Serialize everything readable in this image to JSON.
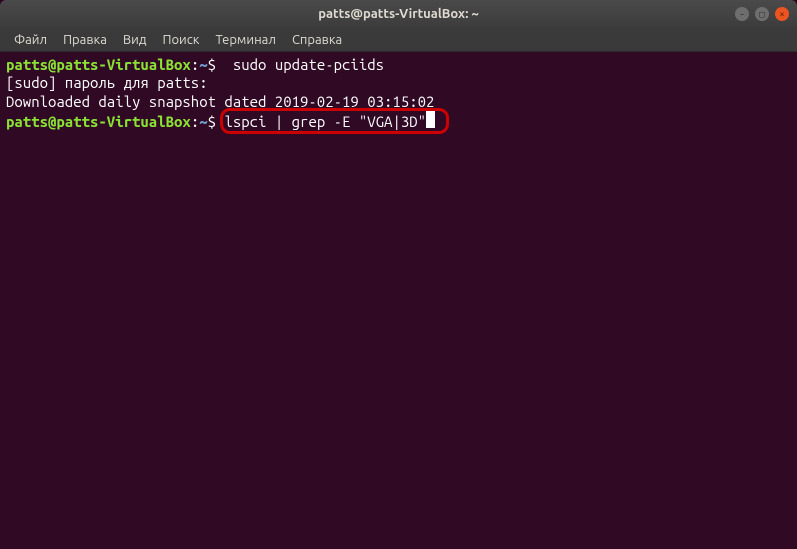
{
  "window": {
    "title": "patts@patts-VirtualBox: ~"
  },
  "menu": {
    "file": "Файл",
    "edit": "Правка",
    "view": "Вид",
    "search": "Поиск",
    "terminal": "Терминал",
    "help": "Справка"
  },
  "terminal": {
    "prompt_user_host": "patts@patts-VirtualBox",
    "prompt_sep": ":",
    "prompt_path": "~",
    "prompt_dollar": "$",
    "lines": {
      "l1_cmd": "  sudo update-pciids",
      "l2": "[sudo] пароль для patts: ",
      "l3": "Downloaded daily snapshot dated 2019-02-19 03:15:02",
      "l4_cmd": "lspci | grep -E \"VGA|3D\""
    }
  }
}
